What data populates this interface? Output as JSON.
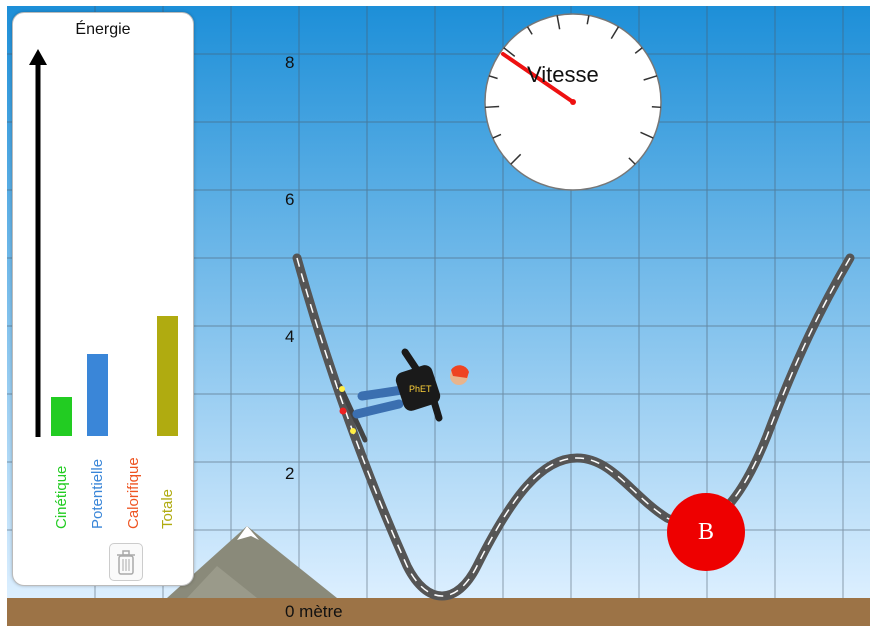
{
  "scene": {
    "y_axis_labels": [
      "8",
      "6",
      "4",
      "2"
    ],
    "ground_label": "0 mètre",
    "colors": {
      "sky_top": "#1d8fd8",
      "sky_bottom": "#dcefff",
      "ground": "#9c7346",
      "track": "#555555"
    }
  },
  "energy_chart": {
    "title": "Énergie",
    "bars": [
      {
        "label": "Cinétique",
        "value": 0.9,
        "color": "#22cc22"
      },
      {
        "label": "Potentielle",
        "value": 1.9,
        "color": "#3a86d8"
      },
      {
        "label": "Calorifique",
        "value": 0,
        "color": "#ee5522"
      },
      {
        "label": "Totale",
        "value": 2.8,
        "color": "#b0ab10"
      }
    ],
    "trash_icon": "trash-icon"
  },
  "speedometer": {
    "label": "Vitesse",
    "needle_color": "#ee1111"
  },
  "marker": {
    "label": "B",
    "color": "#ee0000"
  }
}
